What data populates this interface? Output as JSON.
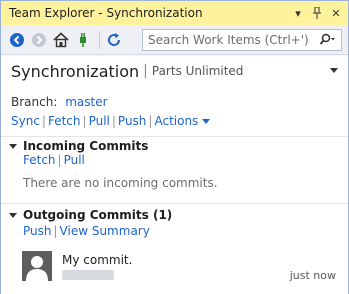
{
  "window": {
    "title": "Team Explorer - Synchronization"
  },
  "toolbar": {
    "search_placeholder": "Search Work Items (Ctrl+')"
  },
  "header": {
    "title": "Synchronization",
    "project": "Parts Unlimited"
  },
  "branch": {
    "label": "Branch:",
    "name": "master"
  },
  "actions": {
    "sync": "Sync",
    "fetch": "Fetch",
    "pull": "Pull",
    "push": "Push",
    "actions": "Actions"
  },
  "incoming": {
    "title": "Incoming Commits",
    "fetch": "Fetch",
    "pull": "Pull",
    "empty": "There are no incoming commits."
  },
  "outgoing": {
    "title": "Outgoing Commits (1)",
    "push": "Push",
    "view_summary": "View Summary"
  },
  "commits": [
    {
      "message": "My commit.",
      "time": "just now"
    }
  ]
}
